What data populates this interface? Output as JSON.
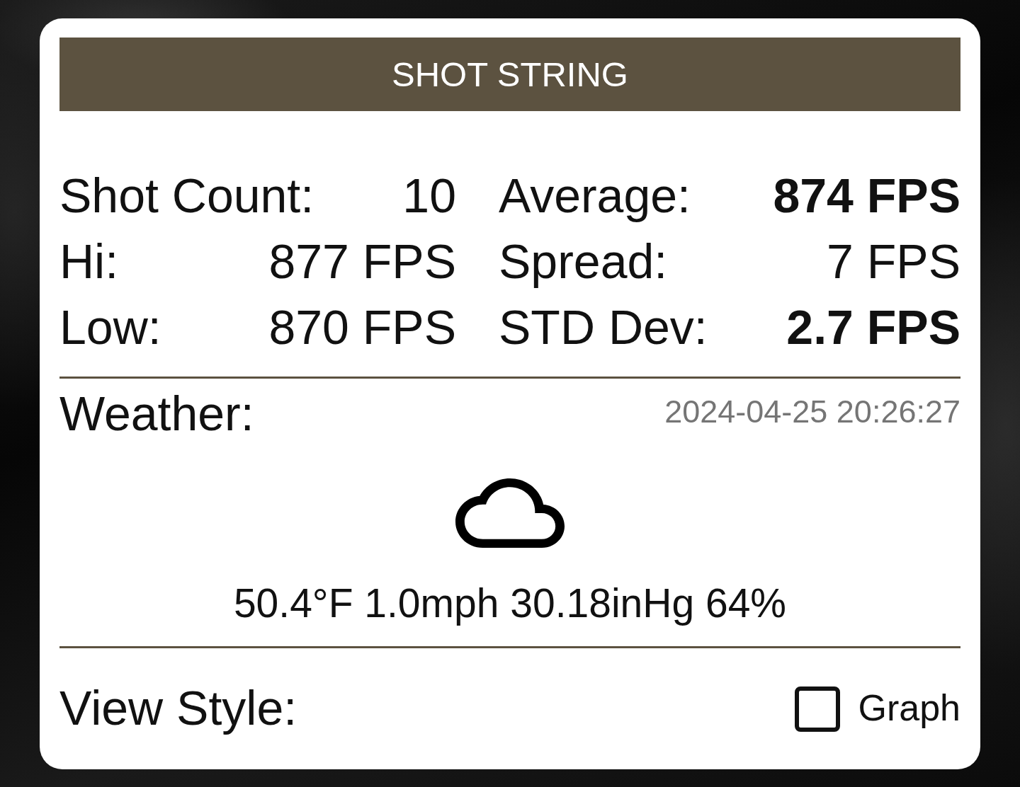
{
  "title_bar": {
    "title": "SHOT STRING"
  },
  "stats": [
    {
      "label": "Shot Count:",
      "value": "10",
      "emphasized": false
    },
    {
      "label": "Average:",
      "value": "874 FPS",
      "emphasized": true
    },
    {
      "label": "Hi:",
      "value": "877 FPS",
      "emphasized": false
    },
    {
      "label": "Spread:",
      "value": "7 FPS",
      "emphasized": false
    },
    {
      "label": "Low:",
      "value": "870 FPS",
      "emphasized": false
    },
    {
      "label": "STD Dev:",
      "value": "2.7 FPS",
      "emphasized": true
    }
  ],
  "weather": {
    "label": "Weather:",
    "timestamp": "2024-04-25 20:26:27",
    "summary": "50.4°F 1.0mph 30.18inHg 64%"
  },
  "view_style": {
    "label": "View Style:",
    "options": [
      {
        "label": "Graph",
        "checked": false
      }
    ]
  }
}
